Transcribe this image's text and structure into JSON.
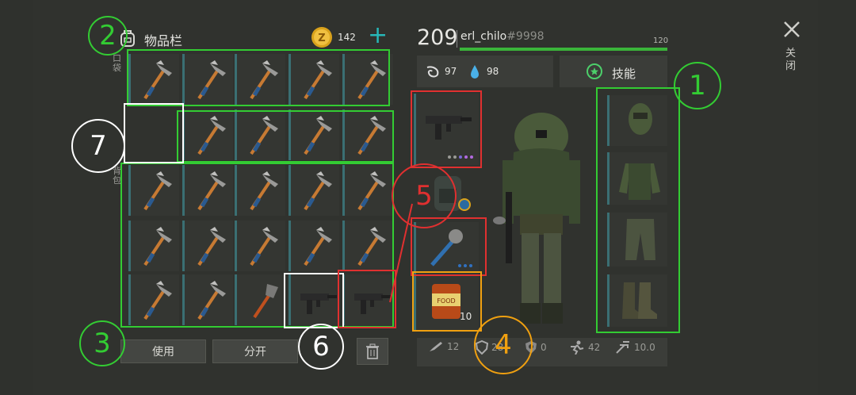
{
  "inventory": {
    "title": "物品栏",
    "pockets_label": "口袋",
    "backpack_label": "背包",
    "coins": "142",
    "add_symbol": "+",
    "use_button": "使用",
    "split_button": "分开"
  },
  "player": {
    "level": "209",
    "name": "erl_chilo",
    "tag": "#9998",
    "xp_max": "120",
    "food": "97",
    "water": "98",
    "skills_label": "技能"
  },
  "equipment": {
    "food_count": "10",
    "can_label": "FOOD"
  },
  "stats": {
    "attack": "12",
    "defense": "28",
    "resist": "0",
    "speed": "42",
    "weight": "10.0"
  },
  "close_label": "关闭",
  "annotations": {
    "n1": "1",
    "n2": "2",
    "n3": "3",
    "n4": "4",
    "n5": "5",
    "n6": "6",
    "n7": "7"
  },
  "colors": {
    "accent_green": "#33cc33",
    "slot_teal": "#3a6f73",
    "annot_red": "#e03030",
    "annot_orange": "#f0a010"
  }
}
